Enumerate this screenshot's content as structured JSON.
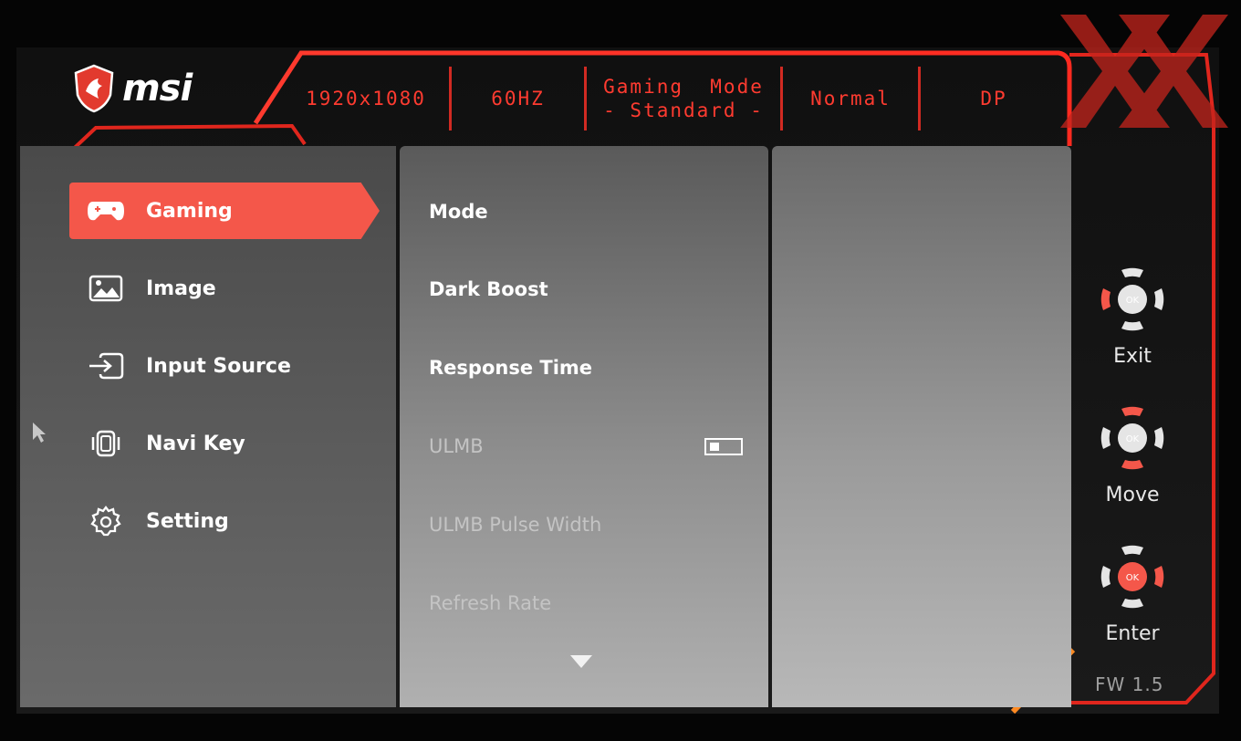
{
  "brand": {
    "logo_text": "msi"
  },
  "status_bar": {
    "resolution": "1920x1080",
    "refresh": "60HZ",
    "mode_line1": "Gaming  Mode",
    "mode_line2": "- Standard -",
    "picture": "Normal",
    "input": "DP"
  },
  "main_menu": [
    {
      "label": "Gaming",
      "icon": "gamepad-icon",
      "active": true
    },
    {
      "label": "Image",
      "icon": "image-icon",
      "active": false
    },
    {
      "label": "Input Source",
      "icon": "input-source-icon",
      "active": false
    },
    {
      "label": "Navi Key",
      "icon": "navi-key-icon",
      "active": false
    },
    {
      "label": "Setting",
      "icon": "gear-icon",
      "active": false
    }
  ],
  "gaming_submenu": [
    {
      "label": "Mode",
      "enabled": true
    },
    {
      "label": "Dark Boost",
      "enabled": true
    },
    {
      "label": "Response Time",
      "enabled": true
    },
    {
      "label": "ULMB",
      "enabled": false,
      "toggle": "off"
    },
    {
      "label": "ULMB Pulse Width",
      "enabled": false
    },
    {
      "label": "Refresh Rate",
      "enabled": false
    }
  ],
  "navi_hints": [
    {
      "label": "Exit",
      "icon": "navi-left-icon"
    },
    {
      "label": "Move",
      "icon": "navi-updown-icon"
    },
    {
      "label": "Enter",
      "icon": "navi-ok-icon"
    }
  ],
  "firmware": "FW 1.5",
  "colors": {
    "accent": "#f4574a",
    "frame": "#e0261d",
    "status_text": "#ff3b30"
  }
}
